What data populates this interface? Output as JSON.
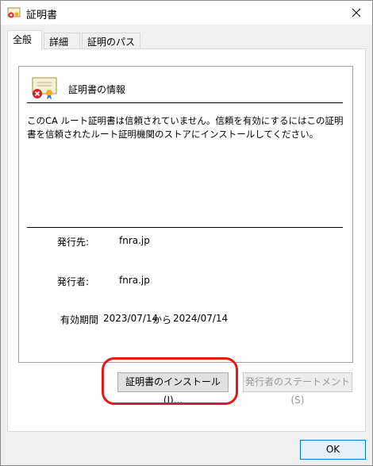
{
  "window": {
    "title": "証明書"
  },
  "tabs": [
    {
      "label": "全般"
    },
    {
      "label": "詳細"
    },
    {
      "label": "証明のパス"
    }
  ],
  "info": {
    "title": "証明書の情報",
    "message": "このCA ルート証明書は信頼されていません。信頼を有効にするにはこの証明書を信頼されたルート証明機関のストアにインストールしてください。",
    "issued_to_label": "発行先:",
    "issued_to_value": "fnra.jp",
    "issued_by_label": "発行者:",
    "issued_by_value": "fnra.jp",
    "valid_label": "有効期間",
    "valid_from": "2023/07/14",
    "valid_sep": "から",
    "valid_to": "2024/07/14"
  },
  "buttons": {
    "install": "証明書のインストール(I)...",
    "issuer_statement": "発行者のステートメント(S)",
    "ok": "OK"
  },
  "colors": {
    "highlight": "#e11a1a",
    "accent": "#0078d7"
  }
}
